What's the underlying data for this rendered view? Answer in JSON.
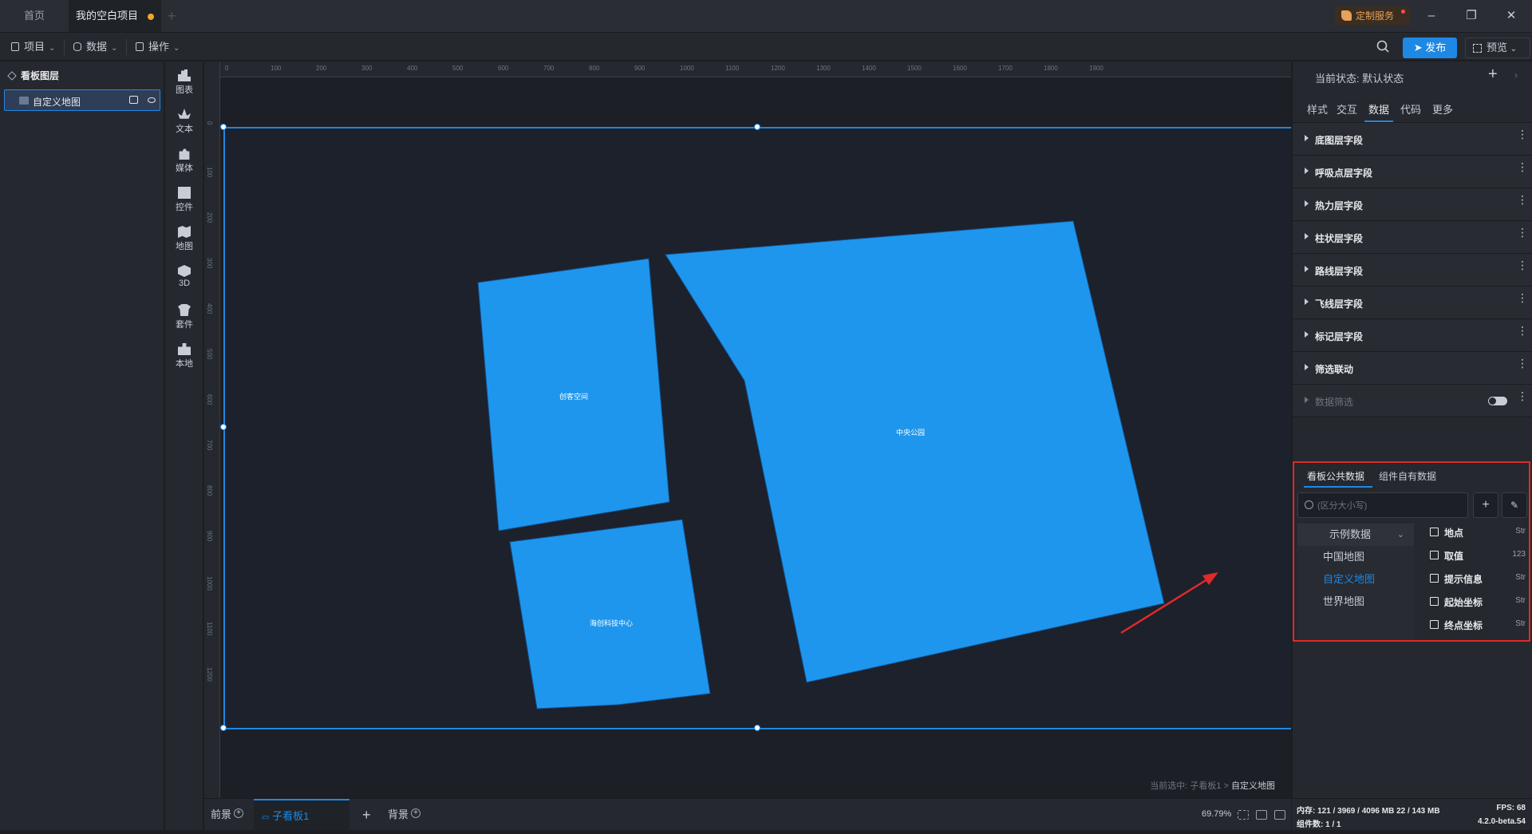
{
  "titlebar": {
    "tabs": [
      {
        "label": "首页"
      },
      {
        "label": "我的空白项目"
      }
    ],
    "custom_service": "定制服务"
  },
  "menubar": {
    "items": [
      {
        "label": "项目"
      },
      {
        "label": "数据"
      },
      {
        "label": "操作"
      }
    ],
    "publish": "发布",
    "preview": "预览"
  },
  "layers": {
    "title": "看板图层",
    "items": [
      {
        "label": "自定义地图"
      }
    ]
  },
  "tools": [
    {
      "label": "图表",
      "icon": "bar-chart-icon"
    },
    {
      "label": "文本",
      "icon": "text-icon"
    },
    {
      "label": "媒体",
      "icon": "media-icon"
    },
    {
      "label": "控件",
      "icon": "control-icon"
    },
    {
      "label": "地图",
      "icon": "map-icon"
    },
    {
      "label": "3D",
      "icon": "cube-icon"
    },
    {
      "label": "套件",
      "icon": "kit-icon"
    },
    {
      "label": "本地",
      "icon": "puzzle-icon"
    }
  ],
  "canvas": {
    "ruler_top": [
      "0",
      "100",
      "200",
      "300",
      "400",
      "500",
      "600",
      "700",
      "800",
      "900",
      "1000",
      "1100",
      "1200",
      "1300",
      "1400",
      "1500",
      "1600",
      "1700",
      "1800",
      "1900"
    ],
    "ruler_left": [
      "0",
      "100",
      "200",
      "300",
      "400",
      "500",
      "600",
      "700",
      "800",
      "900",
      "1000",
      "1100",
      "1200"
    ],
    "regions": [
      {
        "label": "创客空间"
      },
      {
        "label": "中央公园"
      },
      {
        "label": "海创科技中心"
      }
    ],
    "crumb_prefix": "当前选中: 子看板1 >",
    "crumb_current": "自定义地图",
    "region_color": "#1e96ee"
  },
  "bottombar": {
    "tabs": [
      {
        "label": "前景"
      },
      {
        "label": "子看板1"
      },
      {
        "label": "背景"
      }
    ],
    "zoom": "69.79%"
  },
  "rightpanel": {
    "state_label": "当前状态:",
    "state_value": "默认状态",
    "tabs": [
      {
        "label": "样式"
      },
      {
        "label": "交互"
      },
      {
        "label": "数据"
      },
      {
        "label": "代码"
      },
      {
        "label": "更多"
      }
    ],
    "fields": [
      {
        "label": "底图层字段"
      },
      {
        "label": "呼吸点层字段"
      },
      {
        "label": "热力层字段"
      },
      {
        "label": "柱状层字段"
      },
      {
        "label": "路线层字段"
      },
      {
        "label": "飞线层字段"
      },
      {
        "label": "标记层字段"
      },
      {
        "label": "筛选联动"
      },
      {
        "label": "数据筛选"
      }
    ]
  },
  "databox": {
    "tabs": [
      {
        "label": "看板公共数据"
      },
      {
        "label": "组件自有数据"
      }
    ],
    "search_placeholder": "(区分大小写)",
    "sources": [
      {
        "label": "示例数据"
      },
      {
        "label": "中国地图"
      },
      {
        "label": "自定义地图"
      },
      {
        "label": "世界地图"
      }
    ],
    "fields": [
      {
        "name": "地点",
        "type": "Str"
      },
      {
        "name": "取值",
        "type": "123"
      },
      {
        "name": "提示信息",
        "type": "Str"
      },
      {
        "name": "起始坐标",
        "type": "Str"
      },
      {
        "name": "终点坐标",
        "type": "Str"
      }
    ]
  },
  "status": {
    "memory": "内存: 121 / 3969 / 4096 MB 22 / 143 MB",
    "fps": "FPS: 68",
    "components": "组件数: 1 / 1",
    "version": "4.2.0-beta.54"
  }
}
